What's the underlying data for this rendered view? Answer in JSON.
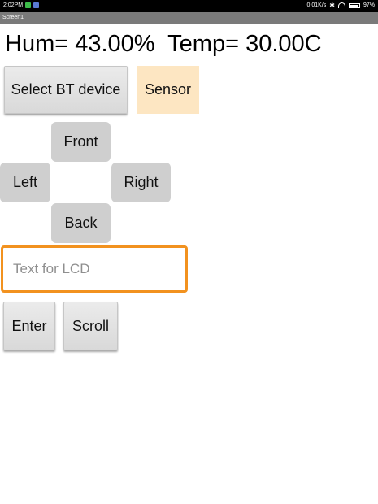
{
  "status_bar": {
    "time": "2:02PM",
    "network_speed": "0.01K/s",
    "battery_percent": "97%",
    "icons": [
      "notification-green-icon",
      "notification-blue-icon",
      "bluetooth-icon",
      "wifi-icon",
      "battery-icon"
    ]
  },
  "title_bar": {
    "title": "Screen1"
  },
  "readout": {
    "text": "Hum= 43.00%  Temp= 30.00C"
  },
  "buttons": {
    "select_bt": "Select BT device",
    "sensor": "Sensor",
    "front": "Front",
    "left": "Left",
    "right": "Right",
    "back": "Back",
    "enter": "Enter",
    "scroll": "Scroll"
  },
  "lcd_input": {
    "placeholder": "Text for LCD",
    "value": ""
  },
  "colors": {
    "accent": "#f2921f",
    "sensor_bg": "#fde6c2",
    "title_bar": "#7a7a7a"
  }
}
